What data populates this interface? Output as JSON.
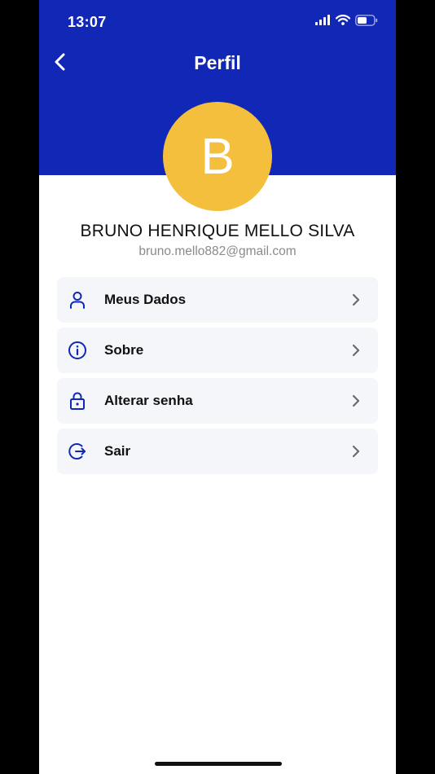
{
  "status_bar": {
    "time": "13:07"
  },
  "header": {
    "title": "Perfil",
    "back_icon": "chevron-left-icon"
  },
  "profile": {
    "avatar_initial": "B",
    "name": "BRUNO HENRIQUE MELLO SILVA",
    "email": "bruno.mello882@gmail.com"
  },
  "menu": {
    "items": [
      {
        "label": "Meus Dados",
        "icon": "user-icon"
      },
      {
        "label": "Sobre",
        "icon": "info-icon"
      },
      {
        "label": "Alterar senha",
        "icon": "lock-icon"
      },
      {
        "label": "Sair",
        "icon": "logout-icon"
      }
    ]
  },
  "colors": {
    "header_bg": "#1127b5",
    "avatar_bg": "#f4bf3d",
    "icon_blue": "#1127b5",
    "item_bg": "#f5f6fa"
  }
}
